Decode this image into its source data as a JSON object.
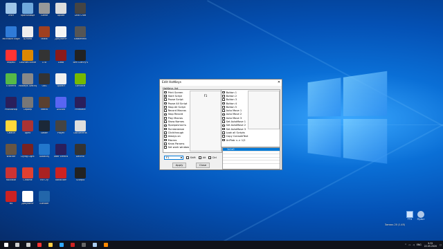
{
  "desktop": {
    "icons": [
      {
        "label": "Этот",
        "color": "#9fc5e8"
      },
      {
        "label": "Хранилище",
        "color": "#6fa8dc"
      },
      {
        "label": "Game",
        "color": "#999999"
      },
      {
        "label": "Архив",
        "color": "#dddddd"
      },
      {
        "label": "Lara Croft",
        "color": "#444444"
      },
      {
        "label": "Microsoft Edge",
        "color": "#2f7bd8"
      },
      {
        "label": "Шляпа",
        "color": "#eeeeee"
      },
      {
        "label": "Mafia",
        "color": "#a04020"
      },
      {
        "label": "Документ",
        "color": "#f5f5f5"
      },
      {
        "label": "Battlefield",
        "color": "#555555"
      },
      {
        "label": "Яндекс",
        "color": "#ff3333"
      },
      {
        "label": "Counter-Strike",
        "color": "#dd8800"
      },
      {
        "label": "GTA",
        "color": "#333333"
      },
      {
        "label": "Dota",
        "color": "#8b1a1a"
      },
      {
        "label": "Tom Clancy's",
        "color": "#222222"
      },
      {
        "label": "uTorrent",
        "color": "#56b947"
      },
      {
        "label": "Hotkeys Settings",
        "color": "#888888"
      },
      {
        "label": "OBS",
        "color": "#333333"
      },
      {
        "label": "Проект",
        "color": "#f0f0f0"
      },
      {
        "label": "GeForce",
        "color": "#76b900"
      },
      {
        "label": "Photoshop",
        "color": "#2a1f5c"
      },
      {
        "label": "Сервер",
        "color": "#777777"
      },
      {
        "label": "Metro",
        "color": "#5a4030"
      },
      {
        "label": "Discord",
        "color": "#5865f2"
      },
      {
        "label": "Premiere",
        "color": "#2a1f5c"
      },
      {
        "label": "Смайл",
        "color": "#ffd83a"
      },
      {
        "label": "Apex",
        "color": "#aa3333"
      },
      {
        "label": "Steam",
        "color": "#1b2838"
      },
      {
        "label": "Player",
        "color": "#444444"
      },
      {
        "label": "Documents",
        "color": "#dddddd"
      },
      {
        "label": "Witcher",
        "color": "#665544"
      },
      {
        "label": "Dying Light",
        "color": "#772222"
      },
      {
        "label": "Audacity",
        "color": "#2277cc"
      },
      {
        "label": "After Effects",
        "color": "#2a1f5c"
      },
      {
        "label": "DaVinci",
        "color": "#333333"
      },
      {
        "label": "Rockstar",
        "color": "#cc3333"
      },
      {
        "label": "Chrome",
        "color": "#e04030"
      },
      {
        "label": "Far Cry",
        "color": "#aa2222"
      },
      {
        "label": "Bandicam",
        "color": "#cc2222"
      },
      {
        "label": "Scorpio",
        "color": "#222222"
      },
      {
        "label": "64",
        "color": "#cc2222"
      },
      {
        "label": "Документ",
        "color": "#ffffff"
      },
      {
        "label": "Blender",
        "color": "#2266aa"
      }
    ]
  },
  "dialog": {
    "title": "Edit HotKeys",
    "list_header": "HotKeys list",
    "hotkeys": [
      {
        "label": "Print Screen",
        "checked": false
      },
      {
        "label": "Start Script",
        "checked": true
      },
      {
        "label": "Pause Script",
        "checked": false
      },
      {
        "label": "Pause All Script",
        "checked": false
      },
      {
        "label": "Stop All Script",
        "checked": false
      },
      {
        "label": "Record Macros",
        "checked": false
      },
      {
        "label": "Stop Record",
        "checked": false
      },
      {
        "label": "Play Macros",
        "checked": false
      },
      {
        "label": "Show Names",
        "checked": false
      },
      {
        "label": "Прозрачность",
        "checked": false
      },
      {
        "label": "Потемнение",
        "checked": false
      },
      {
        "label": "Clickthrough",
        "checked": false
      },
      {
        "label": "Always on",
        "checked": false
      },
      {
        "label": "Macros",
        "checked": false
      },
      {
        "label": "Клик Params",
        "checked": false
      },
      {
        "label": "Set work window",
        "checked": false
      }
    ],
    "assigned_key": "F1",
    "buttons_list": [
      {
        "label": "Button 1",
        "checked": false
      },
      {
        "label": "Button 2",
        "checked": false
      },
      {
        "label": "Button 3",
        "checked": false
      },
      {
        "label": "Button 4",
        "checked": false
      },
      {
        "label": "Button 5",
        "checked": false
      },
      {
        "label": "Auto Move 1",
        "checked": false
      },
      {
        "label": "Auto Move 2",
        "checked": false
      },
      {
        "label": "Auto Move 3",
        "checked": false
      },
      {
        "label": "Set AutoMove 1",
        "checked": false
      },
      {
        "label": "Set AutoMove 2",
        "checked": false
      },
      {
        "label": "Set AutoMove 3",
        "checked": false
      },
      {
        "label": "Look all Scripts",
        "checked": false
      },
      {
        "label": "Copy ConsoleText",
        "checked": false
      },
      {
        "label": "UnPlab <-> 1/2",
        "checked": false
      }
    ],
    "key_select": "F1",
    "shift_label": "Shift",
    "alt_label": "Alt",
    "ctrl_label": "Ctrl",
    "apply_label": "Apply",
    "close_label": "Close",
    "grid_selected": "1x1x0"
  },
  "tray": {
    "record_label": "Запись 20 (1.45)",
    "ttx_label": "TTX",
    "ttx2_label": "Пульт",
    "lang": "ENG",
    "time": "9:32",
    "date": "22.05.2020"
  },
  "taskbar": {
    "icons": [
      {
        "name": "windows-start",
        "color": "#ffffff"
      },
      {
        "name": "search",
        "color": "#cccccc"
      },
      {
        "name": "task-view",
        "color": "#cccccc"
      },
      {
        "name": "yandex",
        "color": "#ff3333"
      },
      {
        "name": "explorer",
        "color": "#ffcc44"
      },
      {
        "name": "photoshop",
        "color": "#31a8ff"
      },
      {
        "name": "app-red",
        "color": "#cc2222"
      },
      {
        "name": "app-dark",
        "color": "#666666"
      },
      {
        "name": "steam",
        "color": "#aaccee"
      },
      {
        "name": "app-orange",
        "color": "#ff8800"
      }
    ]
  }
}
